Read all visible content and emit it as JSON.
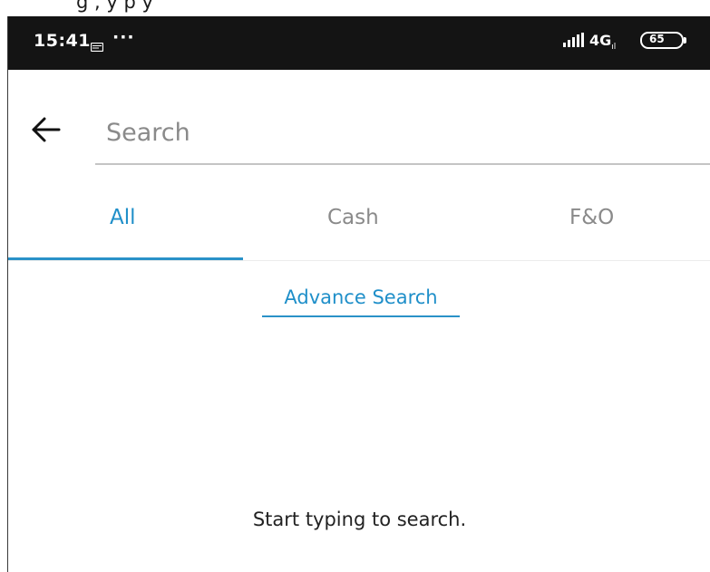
{
  "status_bar": {
    "time": "15:41",
    "dots": "···",
    "network": "4G",
    "battery": "65",
    "icons": [
      "message-icon",
      "signal-icon",
      "battery-icon"
    ]
  },
  "header": {
    "back_icon": "arrow-left-icon",
    "search_placeholder": "Search"
  },
  "tabs": [
    {
      "label": "All",
      "active": true
    },
    {
      "label": "Cash",
      "active": false
    },
    {
      "label": "F&O",
      "active": false
    }
  ],
  "advance_search_label": "Advance Search",
  "empty_state": "Start typing to search.",
  "colors": {
    "accent": "#1f8fc9",
    "status_bar_bg": "#141414",
    "tab_inactive": "#8a8a8a"
  }
}
